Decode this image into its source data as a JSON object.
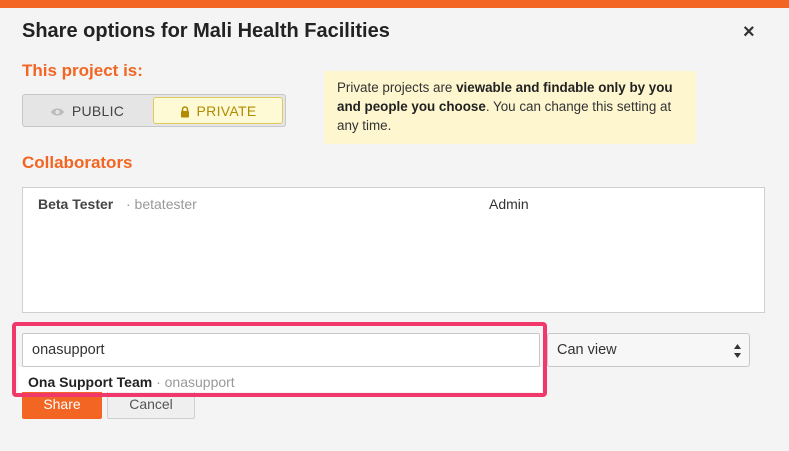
{
  "modal": {
    "title": "Share options for Mali Health Facilities",
    "close": "×"
  },
  "visibility": {
    "label": "This project is:",
    "options": [
      {
        "label": "PUBLIC",
        "icon": "eye-icon",
        "selected": false
      },
      {
        "label": "PRIVATE",
        "icon": "lock-icon",
        "selected": true
      }
    ]
  },
  "info": {
    "text_1": "Private projects are ",
    "bold": "viewable and findable only by you and people you choose",
    "text_2": ". You can change this setting at any time."
  },
  "collaborators": {
    "label": "Collaborators",
    "rows": [
      {
        "name": "Beta Tester",
        "username": " · betatester",
        "role": "Admin"
      }
    ]
  },
  "invite": {
    "input_value": "onasupport",
    "suggestion": {
      "name": "Ona Support Team",
      "username": " · onasupport"
    },
    "permission": "Can view"
  },
  "actions": {
    "share": "Share",
    "cancel": "Cancel"
  },
  "colors": {
    "accent": "#f26522",
    "highlight": "#f0386b",
    "info_bg": "#fdf6cf"
  }
}
